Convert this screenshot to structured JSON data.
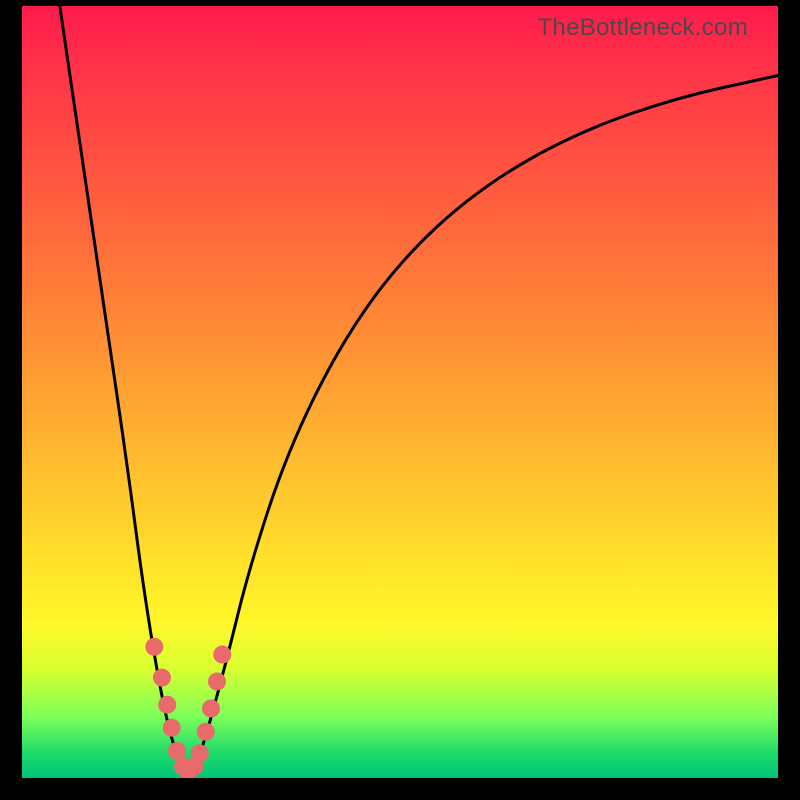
{
  "watermark": "TheBottleneck.com",
  "colors": {
    "background_frame": "#000000",
    "gradient_top": "#ff1a4d",
    "gradient_mid_upper": "#ff8037",
    "gradient_mid_lower": "#ffe12a",
    "gradient_bottom": "#00c475",
    "curve_stroke": "#000000",
    "dot_fill": "#e86a6a",
    "dot_stroke": "#b84040"
  },
  "chart_data": {
    "type": "line",
    "title": "",
    "xlabel": "",
    "ylabel": "",
    "x_range_pct": [
      0,
      100
    ],
    "y_range_pct": [
      0,
      100
    ],
    "note": "Curve is a V-shaped bottleneck profile touching the bottom near x≈22%. Values are percentages of plot bounds (x left→right, y bottom→top).",
    "series": [
      {
        "name": "bottleneck-curve",
        "x_pct": [
          5,
          8,
          11,
          14,
          16,
          18,
          19.5,
          21,
          22,
          23,
          24.5,
          27,
          30,
          35,
          42,
          50,
          60,
          72,
          86,
          100
        ],
        "y_pct": [
          100,
          80,
          60,
          40,
          25,
          13,
          6,
          1.5,
          0,
          1.5,
          6,
          15,
          27,
          42,
          56,
          67,
          76,
          83,
          88,
          91
        ]
      }
    ],
    "highlight_points": {
      "name": "markers",
      "note": "Salmon dots clustered around the curve bottom",
      "x_pct": [
        17.5,
        18.5,
        19.2,
        19.8,
        20.5,
        21.3,
        22.0,
        22.8,
        23.5,
        24.3,
        25.0,
        25.8,
        26.5
      ],
      "y_pct": [
        17.0,
        13.0,
        9.5,
        6.5,
        3.5,
        1.5,
        0.8,
        1.5,
        3.2,
        6.0,
        9.0,
        12.5,
        16.0
      ]
    }
  }
}
